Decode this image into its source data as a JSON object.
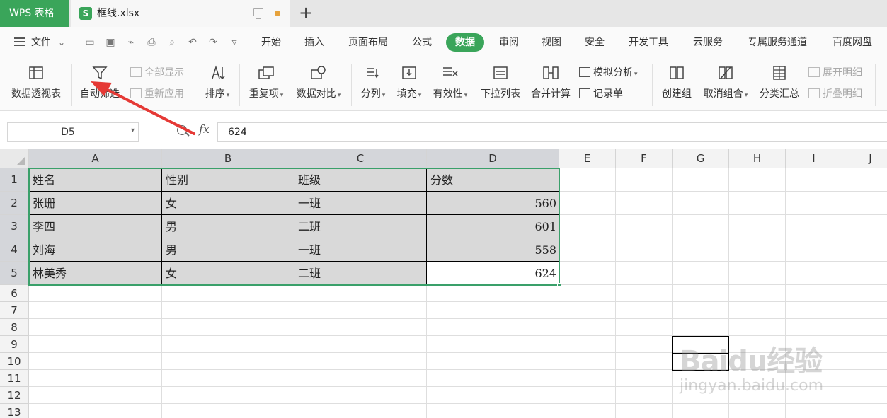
{
  "titlebar": {
    "app_tab": "WPS 表格",
    "file_icon_letter": "S",
    "file_name": "框线.xlsx",
    "new_tab": "+"
  },
  "menubar": {
    "file_label": "文件",
    "tabs": [
      "开始",
      "插入",
      "页面布局",
      "公式",
      "数据",
      "审阅",
      "视图",
      "安全",
      "开发工具",
      "云服务",
      "专属服务通道",
      "百度网盘"
    ],
    "active_tab": "数据"
  },
  "ribbon": {
    "pivot": "数据透视表",
    "autofilter": "自动筛选",
    "show_all": "全部显示",
    "reapply": "重新应用",
    "sort": "排序",
    "duplicates": "重复项",
    "compare": "数据对比",
    "split": "分列",
    "fill": "填充",
    "validity": "有效性",
    "dropdown_list": "下拉列表",
    "consolidate": "合并计算",
    "what_if": "模拟分析",
    "record_form": "记录单",
    "group": "创建组",
    "ungroup": "取消组合",
    "subtotal": "分类汇总",
    "expand": "展开明细",
    "collapse": "折叠明细"
  },
  "formula_bar": {
    "name_box": "D5",
    "fx": "fx",
    "formula": "624"
  },
  "sheet": {
    "columns": [
      "A",
      "B",
      "C",
      "D",
      "E",
      "F",
      "G",
      "H",
      "I",
      "J"
    ],
    "rows": [
      "1",
      "2",
      "3",
      "4",
      "5",
      "6",
      "7",
      "8",
      "9",
      "10",
      "11",
      "12",
      "13"
    ],
    "table": [
      [
        "姓名",
        "性别",
        "班级",
        "分数"
      ],
      [
        "张珊",
        "女",
        "一班",
        "560"
      ],
      [
        "李四",
        "男",
        "二班",
        "601"
      ],
      [
        "刘海",
        "男",
        "一班",
        "558"
      ],
      [
        "林美秀",
        "女",
        "二班",
        "624"
      ]
    ],
    "active_cell": "D5"
  },
  "watermark": {
    "main": "Baidu经验",
    "sub": "jingyan.baidu.com"
  },
  "colors": {
    "accent": "#3aa55a",
    "selection": "#3aa06a",
    "arrow": "#e53935",
    "table_fill": "#d9d9d9"
  }
}
